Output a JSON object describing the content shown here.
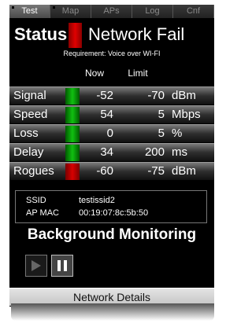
{
  "tabs": [
    {
      "label": "Test",
      "active": true
    },
    {
      "label": "Map",
      "active": false
    },
    {
      "label": "APs",
      "active": false
    },
    {
      "label": "Log",
      "active": false
    },
    {
      "label": "Cnf",
      "active": false
    }
  ],
  "status": {
    "label": "Status",
    "value": "Network Fail",
    "indicator_color": "#d80000"
  },
  "requirement": "Requirement: Voice over WI-FI",
  "table": {
    "headers": {
      "now": "Now",
      "limit": "Limit"
    },
    "rows": [
      {
        "name": "Signal",
        "now": "-52",
        "limit": "-70",
        "unit": "dBm",
        "state": "green"
      },
      {
        "name": "Speed",
        "now": "54",
        "limit": "5",
        "unit": "Mbps",
        "state": "green"
      },
      {
        "name": "Loss",
        "now": "0",
        "limit": "5",
        "unit": "%",
        "state": "green"
      },
      {
        "name": "Delay",
        "now": "34",
        "limit": "200",
        "unit": "ms",
        "state": "green"
      },
      {
        "name": "Rogues",
        "now": "-60",
        "limit": "-75",
        "unit": "dBm",
        "state": "red"
      }
    ]
  },
  "network_info": {
    "ssid_label": "SSID",
    "ssid": "testissid2",
    "ap_mac_label": "AP MAC",
    "ap_mac": "00:19:07:8c:5b:50"
  },
  "background_monitoring": {
    "title": "Background Monitoring",
    "play_icon": "play-icon",
    "pause_icon": "pause-icon"
  },
  "details_button": "Network Details"
}
